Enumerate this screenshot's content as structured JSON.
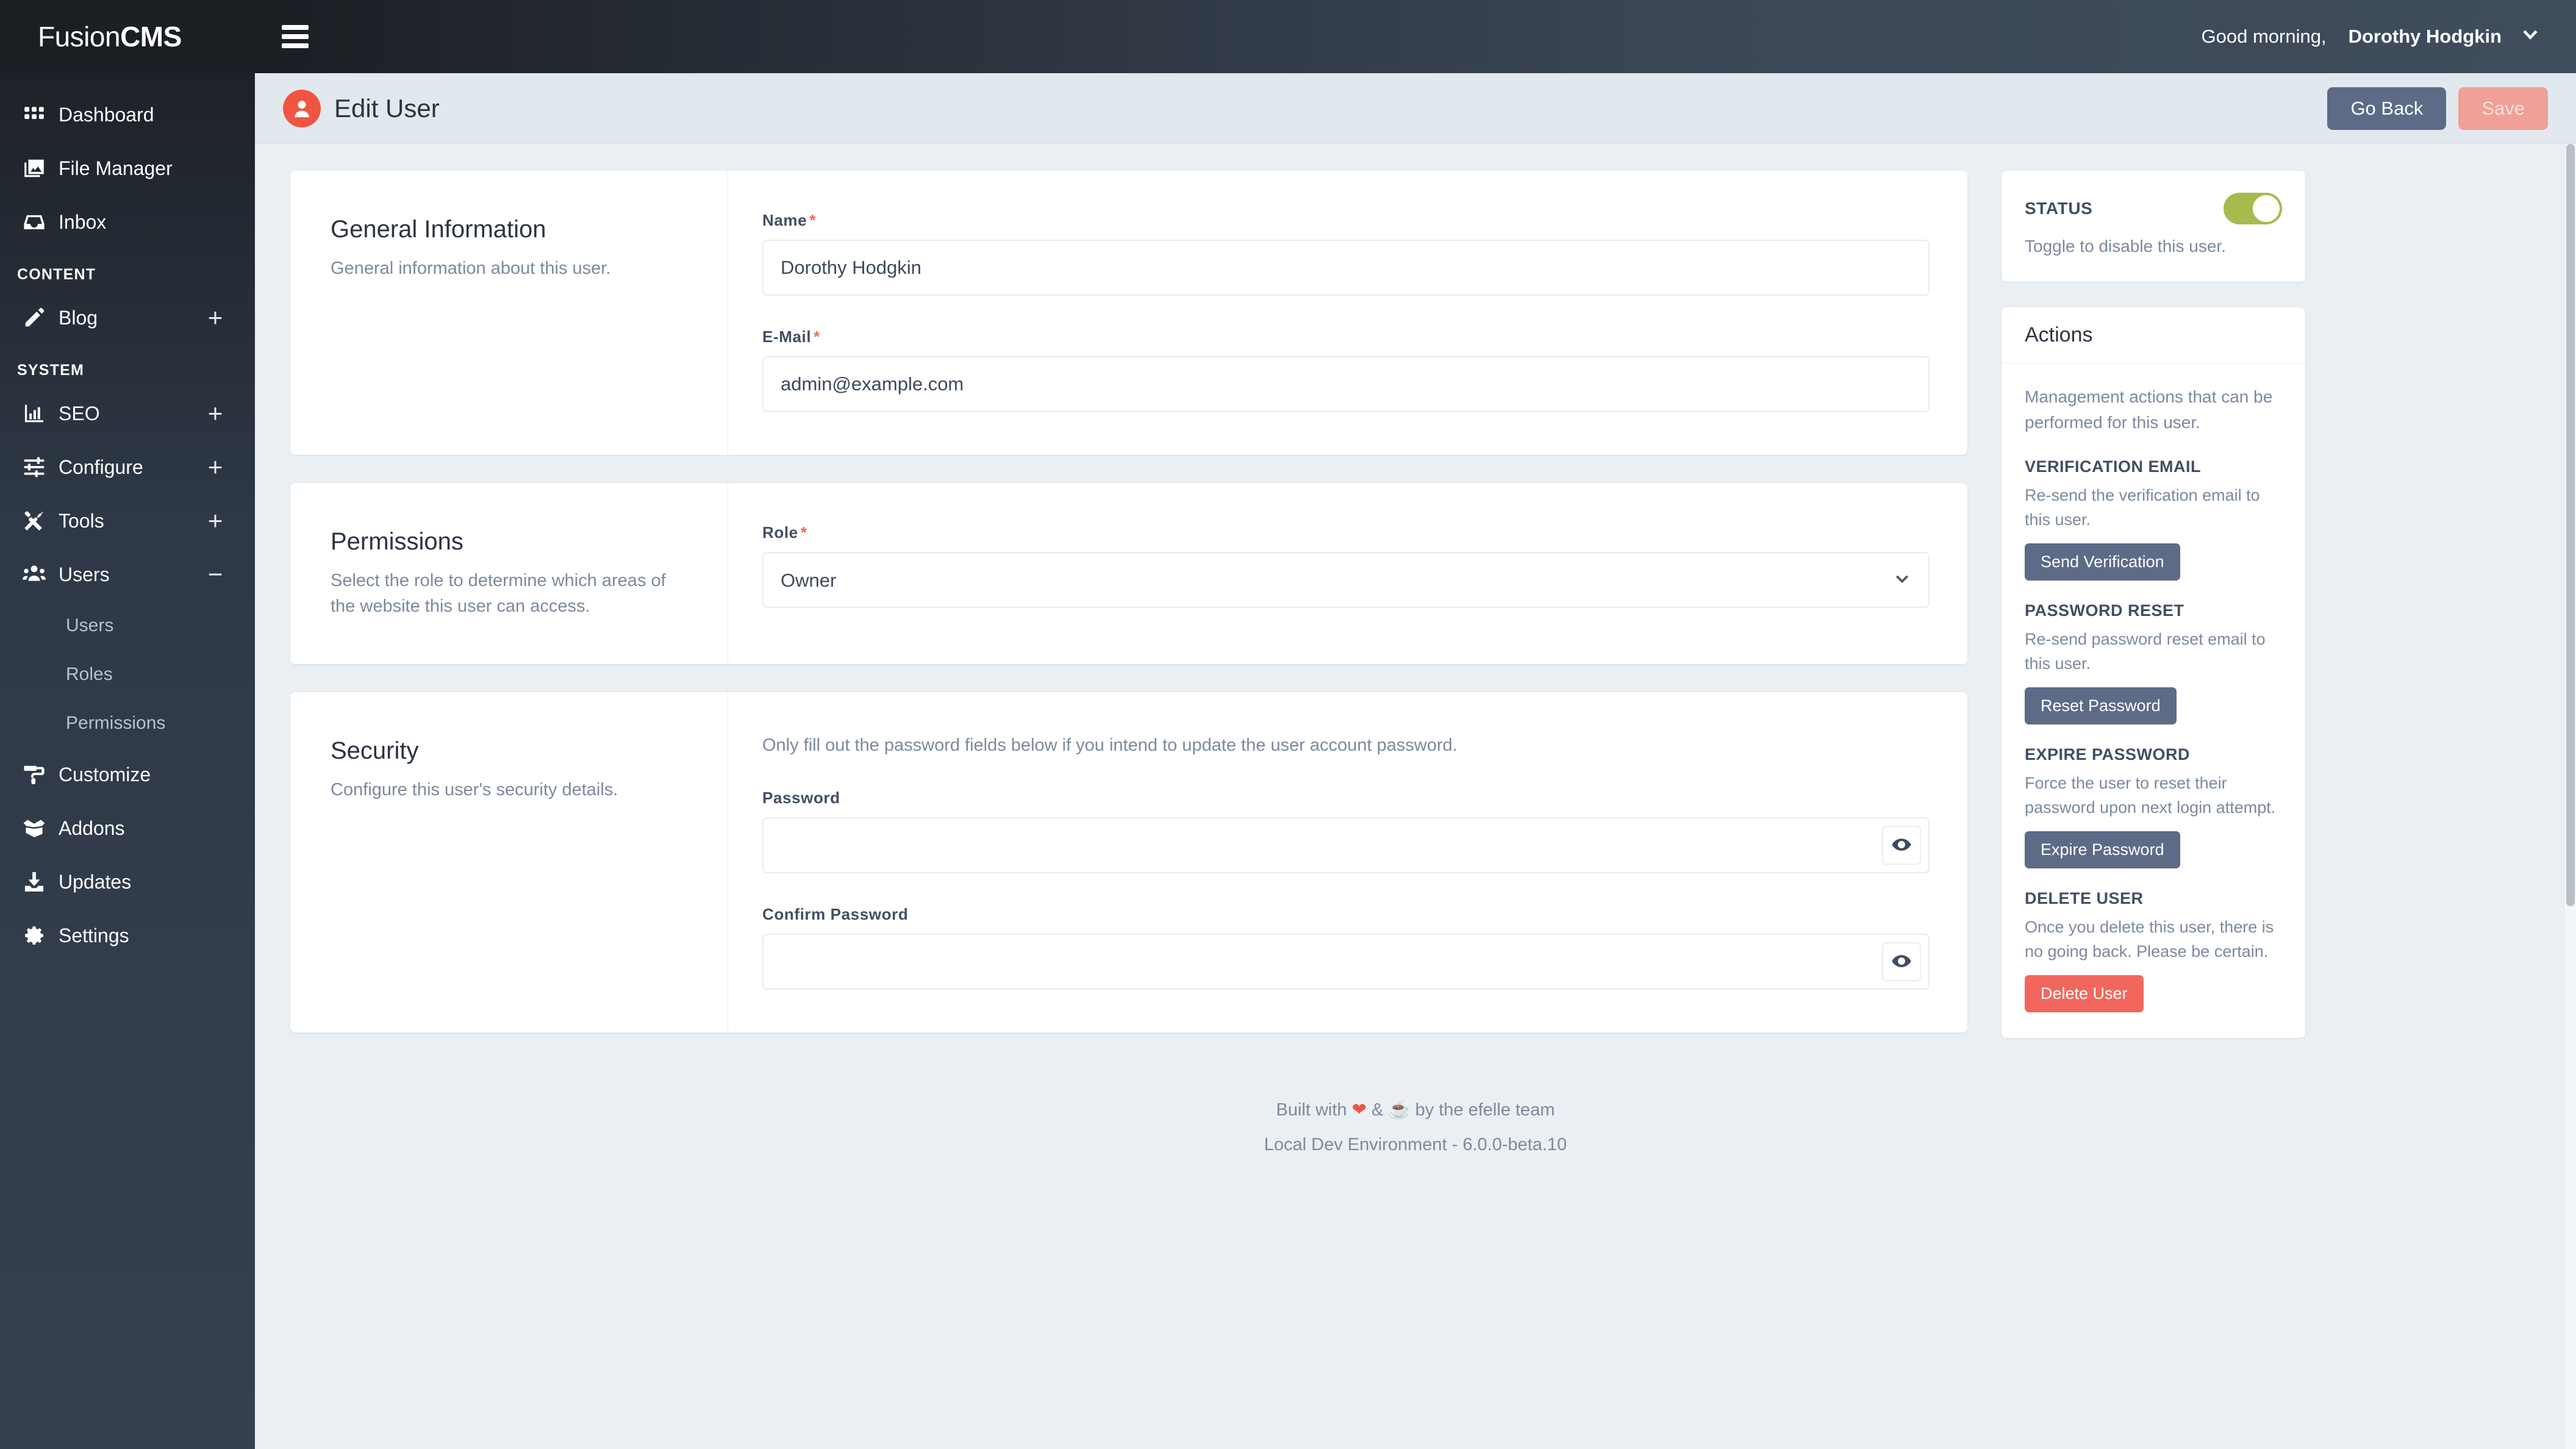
{
  "brand": {
    "light": "Fusion",
    "bold": "CMS"
  },
  "topbar": {
    "hamburger_icon": "hamburger-menu-icon",
    "greeting_prefix": "Good morning,",
    "user_name": "Dorothy Hodgkin",
    "chevron_icon": "chevron-down-icon"
  },
  "sidebar": {
    "primary": [
      {
        "label": "Dashboard",
        "icon": "grid-icon",
        "plus": null
      },
      {
        "label": "File Manager",
        "icon": "images-icon",
        "plus": null
      },
      {
        "label": "Inbox",
        "icon": "inbox-icon",
        "plus": null
      }
    ],
    "content_heading": "CONTENT",
    "content": [
      {
        "label": "Blog",
        "icon": "pencil-icon",
        "plus": "+"
      }
    ],
    "system_heading": "SYSTEM",
    "system": [
      {
        "label": "SEO",
        "icon": "chart-bar-icon",
        "plus": "+"
      },
      {
        "label": "Configure",
        "icon": "sliders-icon",
        "plus": "+"
      },
      {
        "label": "Tools",
        "icon": "tools-icon",
        "plus": "+"
      },
      {
        "label": "Users",
        "icon": "users-icon",
        "plus": "−"
      }
    ],
    "users_children": [
      {
        "label": "Users"
      },
      {
        "label": "Roles"
      },
      {
        "label": "Permissions"
      }
    ],
    "footer_items": [
      {
        "label": "Customize",
        "icon": "paint-roller-icon",
        "plus": null
      },
      {
        "label": "Addons",
        "icon": "box-open-icon",
        "plus": null
      },
      {
        "label": "Updates",
        "icon": "download-icon",
        "plus": null
      },
      {
        "label": "Settings",
        "icon": "gear-icon",
        "plus": null
      }
    ]
  },
  "page_header": {
    "avatar_icon": "user-avatar-icon",
    "avatar_color": "#f05542",
    "title": "Edit User",
    "go_back_label": "Go Back",
    "save_label": "Save"
  },
  "general": {
    "title": "General Information",
    "description": "General information about this user.",
    "name_label": "Name",
    "name_required": "*",
    "name_value": "Dorothy Hodgkin",
    "name_placeholder": "Name",
    "email_label": "E-Mail",
    "email_required": "*",
    "email_value": "admin@example.com",
    "email_placeholder": "E-Mail"
  },
  "permissions": {
    "title": "Permissions",
    "description": "Select the role to determine which areas of the website this user can access.",
    "role_label": "Role",
    "role_required": "*",
    "role_value": "Owner",
    "role_options": [
      "Owner"
    ],
    "chevron_icon": "chevron-down-icon"
  },
  "security": {
    "title": "Security",
    "description": "Configure this user's security details.",
    "help": "Only fill out the password fields below if you intend to update the user account password.",
    "password_label": "Password",
    "password_value": "",
    "password_placeholder": "",
    "confirm_label": "Confirm Password",
    "confirm_value": "",
    "confirm_placeholder": "",
    "eye_icon": "eye-icon"
  },
  "status_card": {
    "label": "STATUS",
    "description": "Toggle to disable this user.",
    "enabled": true,
    "toggle_color": "#a4bc4e"
  },
  "actions_card": {
    "heading": "Actions",
    "intro": "Management actions that can be performed for this user.",
    "items": [
      {
        "title": "VERIFICATION EMAIL",
        "description": "Re-send the verification email to this user.",
        "button": "Send Verification",
        "style": "default"
      },
      {
        "title": "PASSWORD RESET",
        "description": "Re-send password reset email to this user.",
        "button": "Reset Password",
        "style": "default"
      },
      {
        "title": "EXPIRE PASSWORD",
        "description": "Force the user to reset their password upon next login attempt.",
        "button": "Expire Password",
        "style": "default"
      },
      {
        "title": "DELETE USER",
        "description": "Once you delete this user, there is no going back. Please be certain.",
        "button": "Delete User",
        "style": "danger"
      }
    ]
  },
  "footer": {
    "built_pre": "Built with",
    "heart": "❤",
    "amp": "&",
    "coffee": "☕",
    "built_post": "by the efelle team",
    "version": "Local Dev Environment - 6.0.0-beta.10"
  }
}
